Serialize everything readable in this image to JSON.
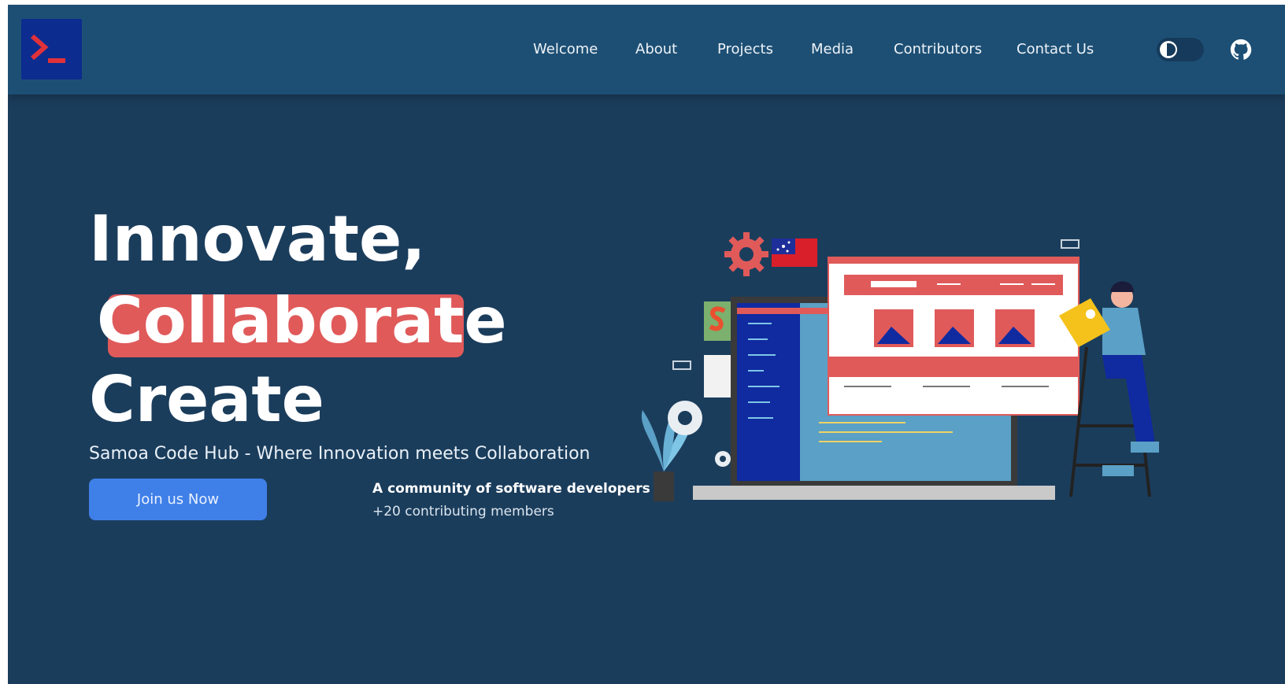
{
  "nav": {
    "links": [
      "Welcome",
      "About",
      "Projects",
      "Media",
      "Contributors",
      "Contact Us"
    ]
  },
  "hero": {
    "line1": "Innovate,",
    "line2": "Collaborate",
    "line3": "Create",
    "tagline": "Samoa Code Hub - Where Innovation meets Collaboration",
    "cta_label": "Join us Now",
    "community_title": "A community of software developers",
    "community_members": "+20 contributing members"
  },
  "colors": {
    "background": "#1b3d5c",
    "navbar": "#1d4f74",
    "accent_red": "#e05a5a",
    "button_blue": "#3f7fe8",
    "logo_blue": "#0c2c8f"
  },
  "icons": {
    "logo": "terminal-prompt-icon",
    "theme": "moon-icon",
    "github": "github-icon"
  }
}
